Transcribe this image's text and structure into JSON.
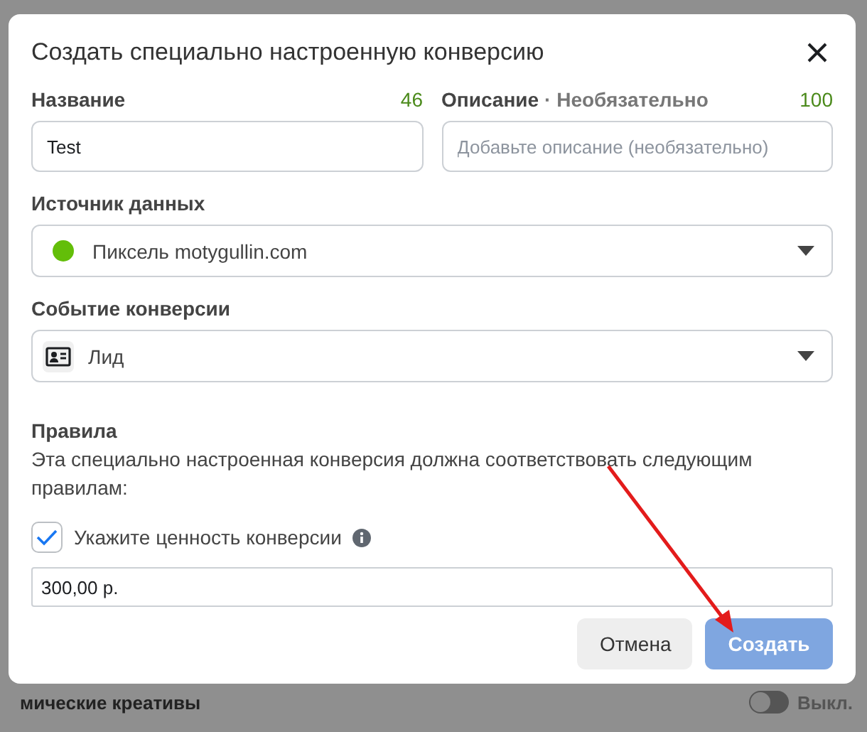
{
  "dialog": {
    "title": "Создать специально настроенную конверсию",
    "name_field": {
      "label": "Название",
      "counter": "46",
      "value": "Test"
    },
    "description_field": {
      "label": "Описание",
      "hint": "· Необязательно",
      "counter": "100",
      "placeholder": "Добавьте описание (необязательно)"
    },
    "data_source": {
      "label": "Источник данных",
      "value": "Пиксель motygullin.com",
      "color": "#63be09"
    },
    "conversion_event": {
      "label": "Событие конверсии",
      "value": "Лид"
    },
    "rules": {
      "title": "Правила",
      "text": "Эта специально настроенная конверсия должна соответствовать следующим правилам:"
    },
    "value_option": {
      "label": "Укажите ценность конверсии",
      "checked": true,
      "value": "300,00 р."
    },
    "buttons": [
      {
        "label": "Отмена",
        "kind": "secondary",
        "disabled": false
      },
      {
        "label": "Создать",
        "kind": "primary",
        "disabled": true
      }
    ]
  },
  "background": {
    "row_label": "мические креативы",
    "toggle": {
      "on": false,
      "label": "Выкл."
    }
  }
}
